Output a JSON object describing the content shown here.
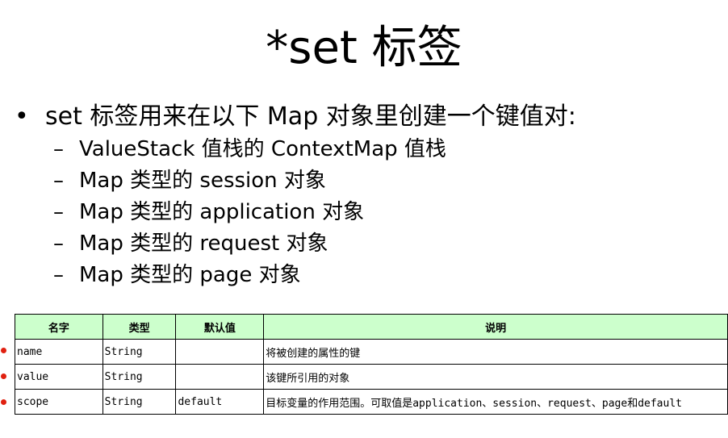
{
  "slide": {
    "title": "*set 标签",
    "bullet": {
      "marker": "•",
      "text": "set 标签用来在以下 Map 对象里创建一个键值对:"
    },
    "sub_marker": "–",
    "sub_items": [
      "ValueStack 值栈的 ContextMap 值栈",
      "Map 类型的 session 对象",
      "Map 类型的 application 对象",
      "Map 类型的 request 对象",
      "Map 类型的 page 对象"
    ]
  },
  "table": {
    "headers": [
      "名字",
      "类型",
      "默认值",
      "说明"
    ],
    "header_color": "#ccffcc",
    "marker_color": "#e02010",
    "rows": [
      [
        "name",
        "String",
        "",
        "将被创建的属性的键"
      ],
      [
        "value",
        "String",
        "",
        "该键所引用的对象"
      ],
      [
        "scope",
        "String",
        "default",
        "目标变量的作用范围。可取值是application、session、request、page和default"
      ]
    ]
  }
}
